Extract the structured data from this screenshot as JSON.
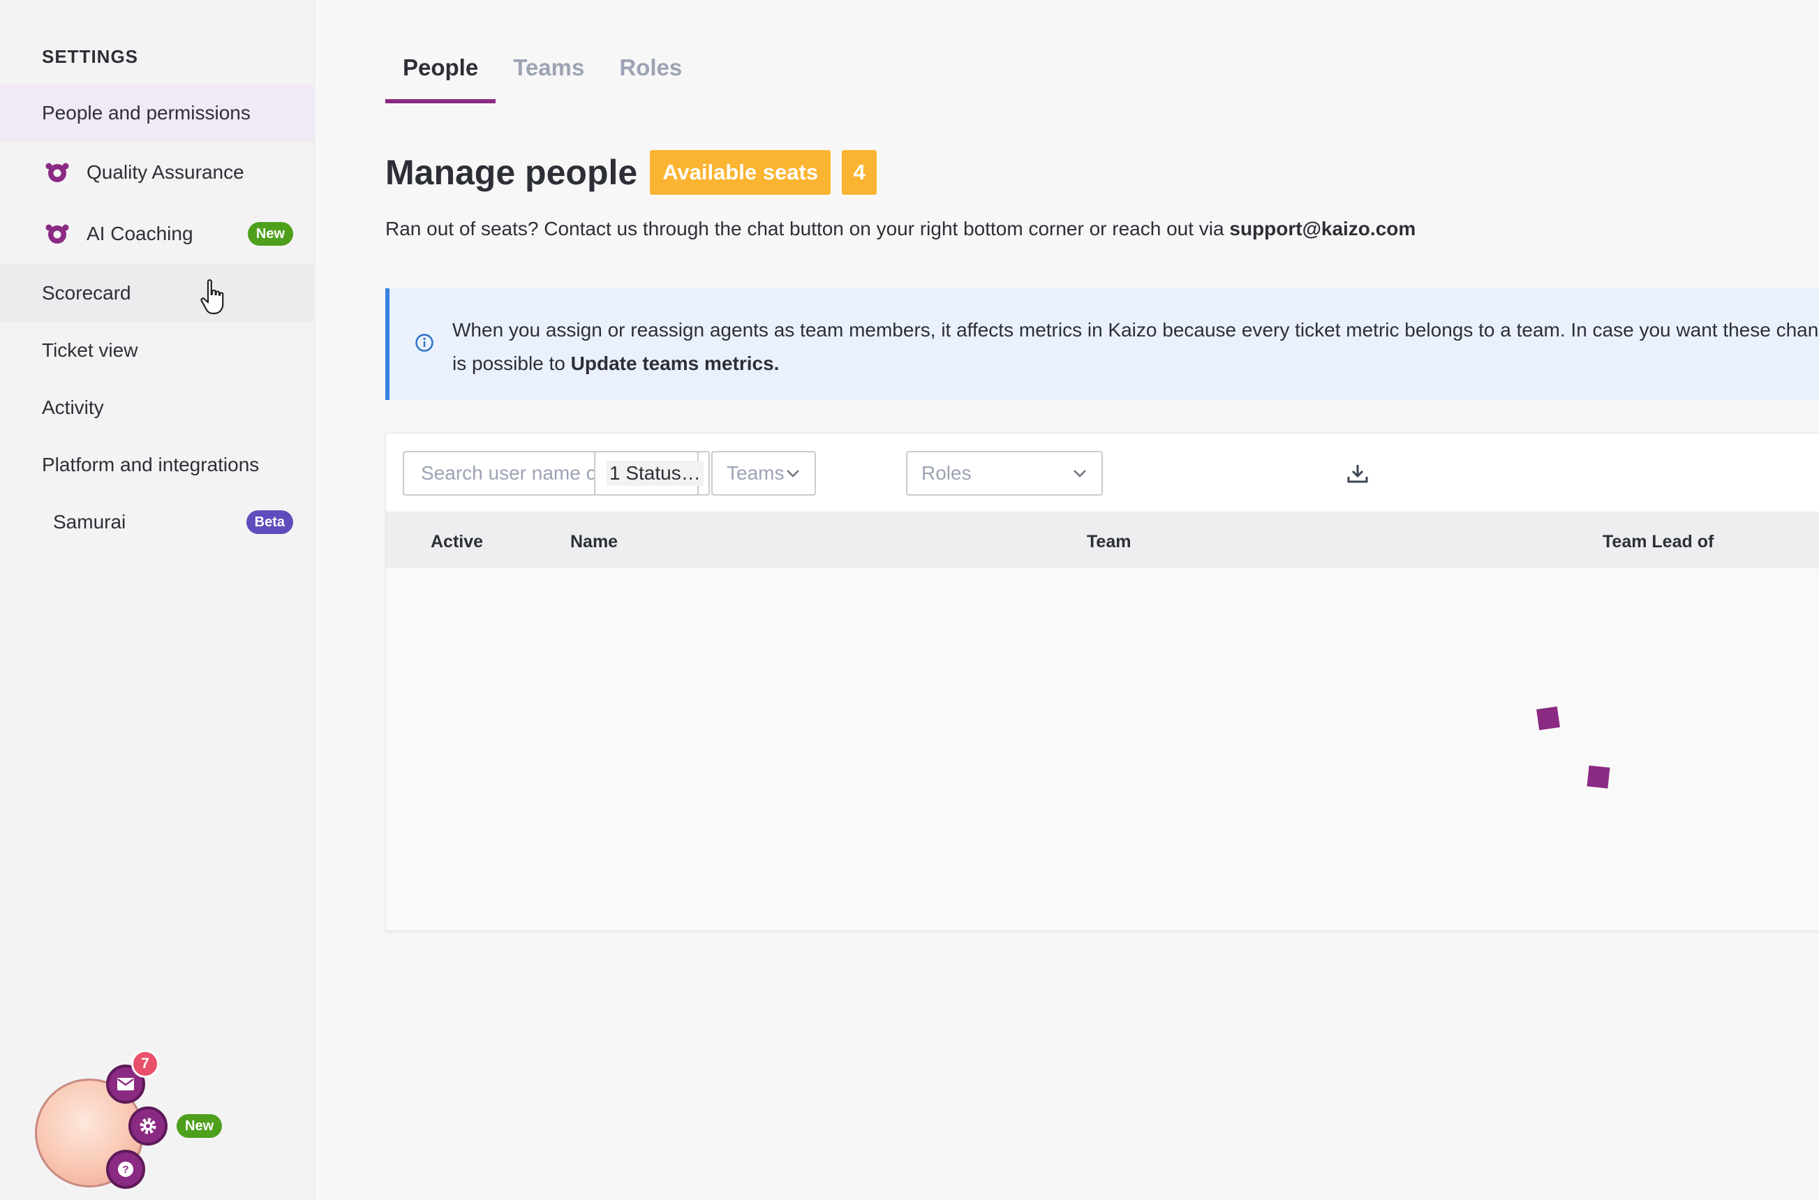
{
  "sidebar": {
    "title": "SETTINGS",
    "items": [
      {
        "label": "People and permissions",
        "state": "active"
      },
      {
        "label": "Quality Assurance",
        "icon": "kaizo-logo-icon"
      },
      {
        "label": "AI Coaching",
        "icon": "kaizo-logo-icon",
        "badge": "New"
      },
      {
        "label": "Scorecard",
        "state": "hover"
      },
      {
        "label": "Ticket view"
      },
      {
        "label": "Activity"
      },
      {
        "label": "Platform and integrations"
      },
      {
        "label": "Samurai",
        "badge": "Beta"
      }
    ]
  },
  "tabs": [
    {
      "label": "People",
      "active": true
    },
    {
      "label": "Teams"
    },
    {
      "label": "Roles"
    }
  ],
  "header": {
    "title": "Manage people",
    "seats_label": "Available seats",
    "seats_count": "4",
    "seats_text": "Ran out of seats? Contact us through the chat button on your right bottom corner or reach out via ",
    "support_email": "support@kaizo.com"
  },
  "info": {
    "icon": "info-circle-icon",
    "line1": "When you assign or reassign agents as team members, it affects metrics in Kaizo because every ticket metric belongs to a team. In case you want these chan",
    "line2_prefix": "is possible to ",
    "line2_link": "Update teams metrics."
  },
  "filters": {
    "search_placeholder": "Search user name or email",
    "status_value": "1 Status…",
    "teams_placeholder": "Teams",
    "roles_placeholder": "Roles",
    "download_icon": "download-icon"
  },
  "table": {
    "columns": [
      "Active",
      "Name",
      "Team",
      "Team Lead of"
    ]
  },
  "widget": {
    "notification_count": "7",
    "new_label": "New",
    "icons": [
      "mail-icon",
      "gear-icon",
      "help-icon"
    ]
  },
  "colors": {
    "accent": "#8a2a83",
    "seats": "#fbb431",
    "info_border": "#3582e0",
    "info_bg": "#eaf1fc",
    "badge_new": "#4ea01c",
    "badge_beta": "#5f4dbd"
  }
}
